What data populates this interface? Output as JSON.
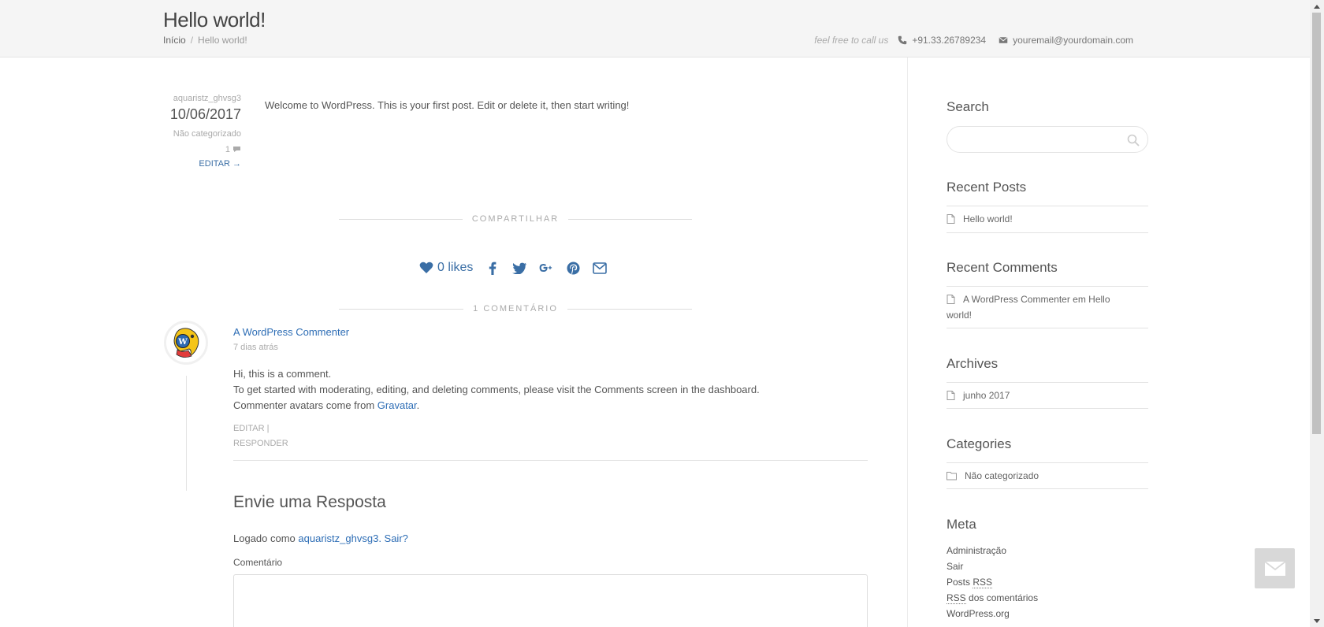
{
  "header": {
    "title": "Hello world!",
    "breadcrumb": {
      "home": "Início",
      "separator": "/",
      "current": "Hello world!"
    },
    "contact": {
      "tagline": "feel free to call us",
      "phone": "+91.33.26789234",
      "email": "youremail@yourdomain.com"
    }
  },
  "post": {
    "author": "aquaristz_ghvsg3",
    "date": "10/06/2017",
    "category": "Não categorizado",
    "comment_count": "1",
    "edit_label": "EDITAR →",
    "content": "Welcome to WordPress. This is your first post. Edit or delete it, then start writing!"
  },
  "share": {
    "heading": "COMPARTILHAR",
    "likes": "0 likes"
  },
  "comments": {
    "heading": "1 COMENTÁRIO",
    "items": [
      {
        "author": "A WordPress Commenter",
        "time": "7 dias atrás",
        "line1": "Hi, this is a comment.",
        "line2": "To get started with moderating, editing, and deleting comments, please visit the Comments screen in the dashboard.",
        "line3_prefix": "Commenter avatars come from",
        "line3_link": "Gravatar",
        "line3_suffix": ".",
        "edit": "EDITAR |",
        "reply": "RESPONDER"
      }
    ]
  },
  "reply_form": {
    "title": "Envie uma Resposta",
    "logged_prefix": "Logado como",
    "user_link": "aquaristz_ghvsg3",
    "logout_link": ". Sair?",
    "comment_label": "Comentário"
  },
  "sidebar": {
    "search_title": "Search",
    "recent_posts_title": "Recent Posts",
    "recent_posts": [
      "Hello world!"
    ],
    "recent_comments_title": "Recent Comments",
    "recent_comment_line1": "A WordPress Commenter em Hello",
    "recent_comment_line2": "world!",
    "archives_title": "Archives",
    "archives": [
      "junho 2017"
    ],
    "categories_title": "Categories",
    "categories": [
      "Não categorizado"
    ],
    "meta_title": "Meta",
    "meta": {
      "admin": "Administração",
      "logout": "Sair",
      "posts_prefix": "Posts",
      "rss": "RSS",
      "comments_suffix": "dos comentários",
      "wordpress": "WordPress.org"
    }
  },
  "colors": {
    "link": "#2d6db5",
    "share": "#3a6ea5",
    "header_bg": "#f5f5f5"
  },
  "icons": [
    "phone-icon",
    "envelope-icon",
    "comment-icon",
    "heart-icon",
    "facebook-icon",
    "twitter-icon",
    "google-plus-icon",
    "pinterest-icon",
    "email-share-icon",
    "search-icon",
    "document-icon",
    "folder-icon",
    "mail-fab-icon"
  ]
}
